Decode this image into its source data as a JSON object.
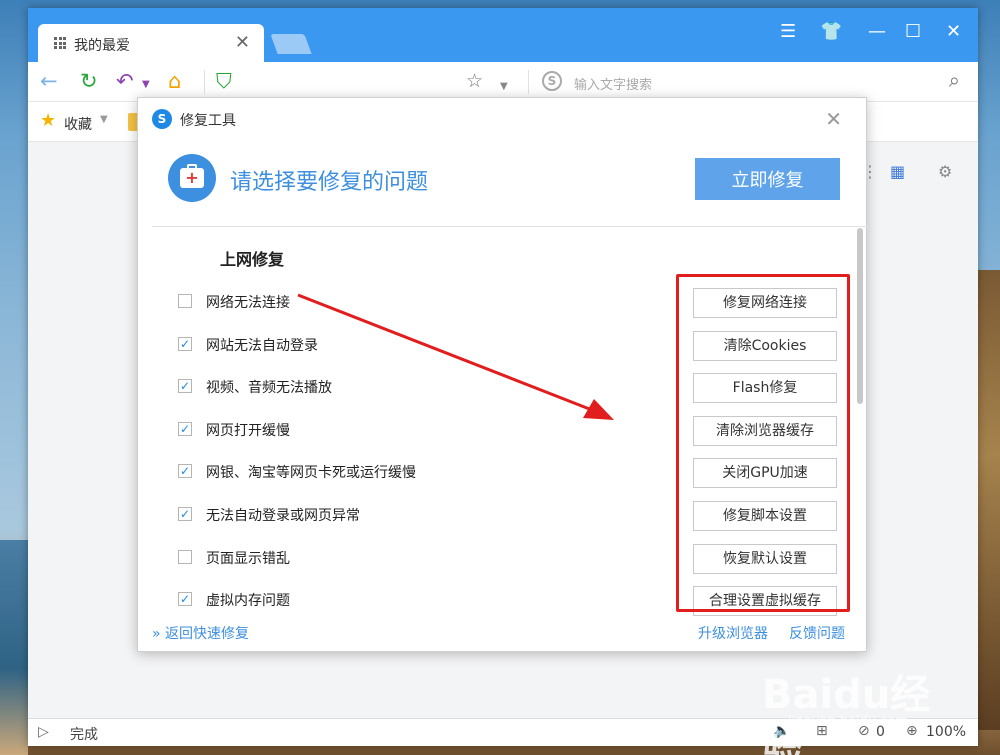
{
  "tab": {
    "title": "我的最爱"
  },
  "search": {
    "placeholder": "输入文字搜索"
  },
  "bookmarks": {
    "favorites_label": "收藏"
  },
  "status": {
    "text": "完成",
    "count": "0",
    "zoom": "100%"
  },
  "dialog": {
    "title": "修复工具",
    "headline": "请选择要修复的问题",
    "repair_now": "立即修复",
    "section": "上网修复",
    "items": [
      {
        "label": "网络无法连接",
        "checked": false,
        "button": "修复网络连接"
      },
      {
        "label": "网站无法自动登录",
        "checked": true,
        "button": "清除Cookies"
      },
      {
        "label": "视频、音频无法播放",
        "checked": true,
        "button": "Flash修复"
      },
      {
        "label": "网页打开缓慢",
        "checked": true,
        "button": "清除浏览器缓存"
      },
      {
        "label": "网银、淘宝等网页卡死或运行缓慢",
        "checked": true,
        "button": "关闭GPU加速"
      },
      {
        "label": "无法自动登录或网页异常",
        "checked": true,
        "button": "修复脚本设置"
      },
      {
        "label": "页面显示错乱",
        "checked": false,
        "button": "恢复默认设置"
      },
      {
        "label": "虚拟内存问题",
        "checked": true,
        "button": "合理设置虚拟缓存"
      }
    ],
    "back_link": "返回快速修复",
    "upgrade_link": "升级浏览器",
    "feedback_link": "反馈问题"
  },
  "watermark": {
    "brand": "Baidu经验",
    "sub": "jingyan.baidu.com"
  },
  "colors": {
    "accent": "#3d8fe0",
    "titlebar": "#3b98f0",
    "annotation": "#e21d1d"
  },
  "icons": [
    "grid-icon",
    "back-icon",
    "refresh-icon",
    "undo-icon",
    "home-icon",
    "shield-icon",
    "star-icon",
    "search-icon",
    "settings-icon",
    "medkit-icon"
  ]
}
